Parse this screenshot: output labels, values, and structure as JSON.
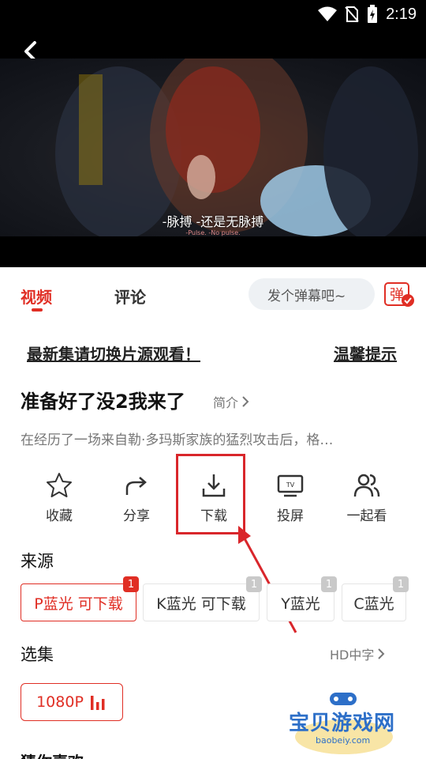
{
  "status_bar": {
    "time": "2:19"
  },
  "video": {
    "subtitle_cn": "-脉搏 -还是无脉搏",
    "subtitle_en": "-Pulse. -No pulse."
  },
  "tabs": [
    {
      "label": "视频",
      "active": true
    },
    {
      "label": "评论",
      "active": false
    }
  ],
  "danmu": {
    "placeholder": "发个弹幕吧~",
    "button_label": "弹"
  },
  "notice": {
    "left": "最新集请切换片源观看！",
    "right": "温馨提示"
  },
  "title": "准备好了没2我来了",
  "intro_label": "简介",
  "description": "在经历了一场来自勒·多玛斯家族的猛烈攻击后，格…",
  "actions": [
    {
      "label": "收藏",
      "icon": "star-icon"
    },
    {
      "label": "分享",
      "icon": "share-icon"
    },
    {
      "label": "下载",
      "icon": "download-icon"
    },
    {
      "label": "投屏",
      "icon": "tv-cast-icon"
    },
    {
      "label": "一起看",
      "icon": "users-icon"
    }
  ],
  "source": {
    "title": "来源",
    "items": [
      {
        "label": "P蓝光 可下载",
        "badge": "1",
        "active": true
      },
      {
        "label": "K蓝光 可下载",
        "badge": "1",
        "active": false
      },
      {
        "label": "Y蓝光",
        "badge": "1",
        "active": false
      },
      {
        "label": "C蓝光",
        "badge": "1",
        "active": false
      }
    ]
  },
  "episodes": {
    "title": "选集",
    "hd_label": "HD中字",
    "items": [
      {
        "label": "1080P"
      }
    ]
  },
  "bottom_cut_text": "猜你喜欢",
  "watermark": {
    "text": "宝贝游戏网",
    "url": "baobeiy.com"
  },
  "colors": {
    "accent": "#e02e24",
    "annotation": "#d9262b",
    "watermark": "#2d6fc8"
  }
}
